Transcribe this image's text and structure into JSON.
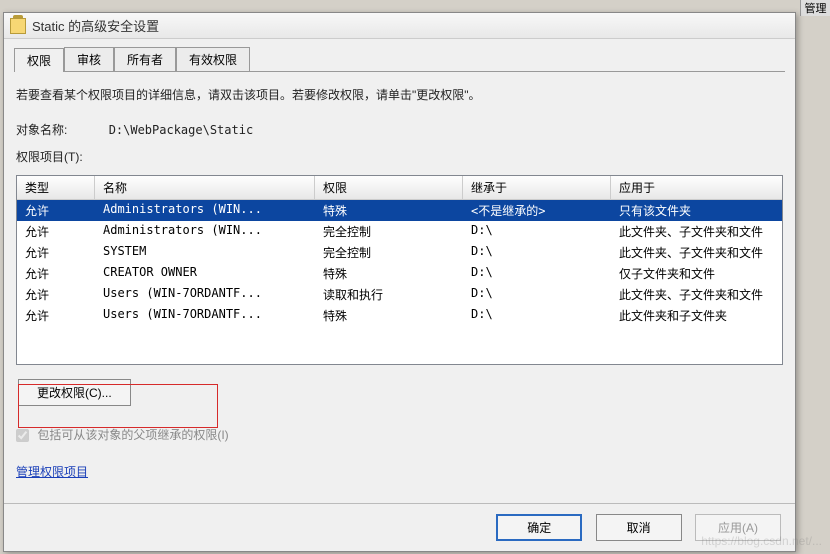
{
  "window": {
    "title": "Static 的高级安全设置"
  },
  "tabs": [
    "权限",
    "审核",
    "所有者",
    "有效权限"
  ],
  "active_tab": 0,
  "instruction": "若要查看某个权限项目的详细信息，请双击该项目。若要修改权限，请单击\"更改权限\"。",
  "object_label": "对象名称:",
  "object_value": "D:\\WebPackage\\Static",
  "list_label": "权限项目(T):",
  "columns": [
    "类型",
    "名称",
    "权限",
    "继承于",
    "应用于"
  ],
  "rows": [
    {
      "type": "允许",
      "name": "Administrators (WIN...",
      "perm": "特殊",
      "inherit": "<不是继承的>",
      "apply": "只有该文件夹"
    },
    {
      "type": "允许",
      "name": "Administrators (WIN...",
      "perm": "完全控制",
      "inherit": "D:\\",
      "apply": "此文件夹、子文件夹和文件"
    },
    {
      "type": "允许",
      "name": "SYSTEM",
      "perm": "完全控制",
      "inherit": "D:\\",
      "apply": "此文件夹、子文件夹和文件"
    },
    {
      "type": "允许",
      "name": "CREATOR OWNER",
      "perm": "特殊",
      "inherit": "D:\\",
      "apply": "仅子文件夹和文件"
    },
    {
      "type": "允许",
      "name": "Users (WIN-7ORDANTF...",
      "perm": "读取和执行",
      "inherit": "D:\\",
      "apply": "此文件夹、子文件夹和文件"
    },
    {
      "type": "允许",
      "name": "Users (WIN-7ORDANTF...",
      "perm": "特殊",
      "inherit": "D:\\",
      "apply": "此文件夹和子文件夹"
    }
  ],
  "change_btn": "更改权限(C)...",
  "include_checkbox": "包括可从该对象的父项继承的权限(I)",
  "manage_link": "管理权限项目",
  "buttons": {
    "ok": "确定",
    "cancel": "取消",
    "apply": "应用(A)"
  },
  "bg_label": "管理"
}
